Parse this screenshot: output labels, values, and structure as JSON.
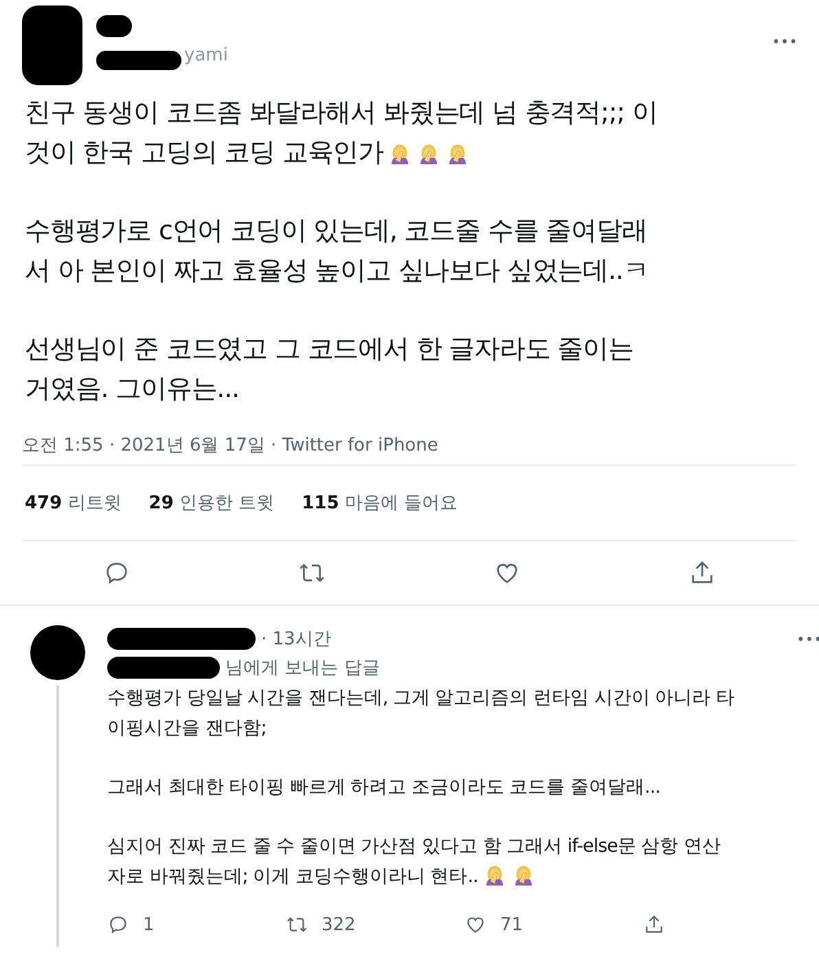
{
  "tweet": {
    "handle_visible": "yami",
    "paragraphs": [
      {
        "lines": [
          "친구 동생이 코드좀 봐달라해서 봐줬는데 넘 충격적;;; 이",
          "것이 한국 고딩의 코딩 교육인가"
        ],
        "emojis": [
          {
            "kind": "facepalm"
          },
          {
            "kind": "facepalm"
          },
          {
            "kind": "facepalm"
          }
        ]
      },
      {
        "lines": [
          "수행평가로 c언어 코딩이 있는데, 코드줄 수를 줄여달래",
          "서 아 본인이 짜고 효율성 높이고 싶나보다 싶었는데..ㅋ"
        ]
      },
      {
        "lines": [
          "선생님이 준 코드였고 그 코드에서 한 글자라도 줄이는",
          "거였음. 그이유는..."
        ]
      }
    ],
    "meta": "오전 1:55 · 2021년 6월 17일 · Twitter for iPhone",
    "stats": [
      {
        "count": "479",
        "label": "리트윗"
      },
      {
        "count": "29",
        "label": "인용한 트윗"
      },
      {
        "count": "115",
        "label": "마음에 들어요"
      }
    ],
    "actions": [
      {
        "kind": "reply"
      },
      {
        "kind": "retweet"
      },
      {
        "kind": "like"
      },
      {
        "kind": "share"
      }
    ]
  },
  "reply": {
    "time": "· 13시간",
    "replying_to": "님에게 보내는 답글",
    "paragraphs": [
      {
        "lines": [
          "수행평가 당일날 시간을 잰다는데, 그게 알고리즘의 런타임 시간이 아니라 타",
          "이핑시간을 잰다함;"
        ]
      },
      {
        "lines": [
          "그래서 최대한 타이핑 빠르게 하려고 조금이라도 코드를 줄여달래..."
        ]
      },
      {
        "lines": [
          "심지어 진짜 코드 줄 수 줄이면 가산점 있다고 함 그래서 if-else문 삼항 연산",
          "자로 바꿔줬는데; 이게 코딩수행이라니 현타.."
        ],
        "emojis": [
          {
            "kind": "facepalm"
          },
          {
            "kind": "facepalm"
          }
        ]
      }
    ],
    "actions": [
      {
        "kind": "reply",
        "count": "1"
      },
      {
        "kind": "retweet",
        "count": "322"
      },
      {
        "kind": "like",
        "count": "71"
      },
      {
        "kind": "share"
      }
    ]
  }
}
